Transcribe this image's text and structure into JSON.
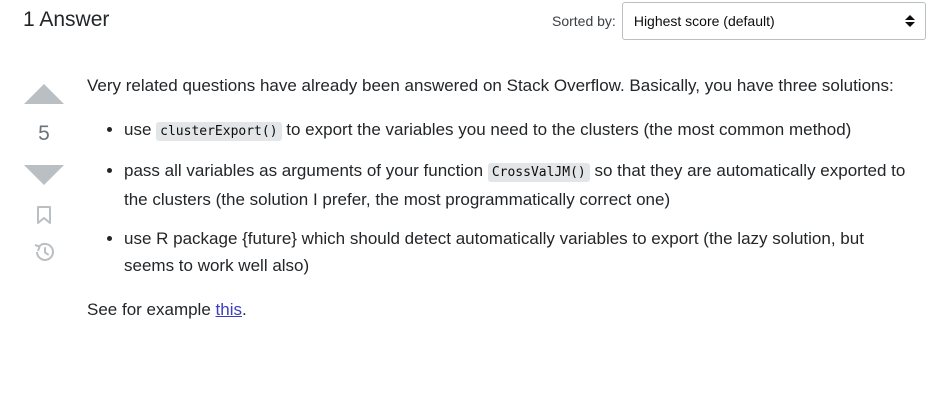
{
  "header": {
    "title": "1 Answer"
  },
  "sort": {
    "label": "Sorted by:",
    "value": "Highest score (default)"
  },
  "vote": {
    "count": "5"
  },
  "answer": {
    "intro": "Very related questions have already been answered on Stack Overflow. Basically, you have three solutions:",
    "items": [
      {
        "pre": "use ",
        "code": "clusterExport()",
        "post": " to export the variables you need to the clusters (the most common method)"
      },
      {
        "pre": "pass all variables as arguments of your function ",
        "code": "CrossValJM()",
        "post": " so that they are automatically exported to the clusters (the solution I prefer, the most programmatically correct one)"
      },
      {
        "pre": "use R package {future} which should detect automatically variables to export (the lazy solution, but seems to work well also)",
        "code": "",
        "post": ""
      }
    ],
    "footer_pre": "See for example ",
    "footer_link": "this",
    "footer_post": "."
  },
  "colors": {
    "link": "#3c3cbe",
    "vote_arrow": "#babfc4",
    "code_bg": "#e3e6e8"
  },
  "icons": {
    "upvote": "triangle-up",
    "downvote": "triangle-down",
    "bookmark": "bookmark-icon",
    "history": "history-icon"
  }
}
